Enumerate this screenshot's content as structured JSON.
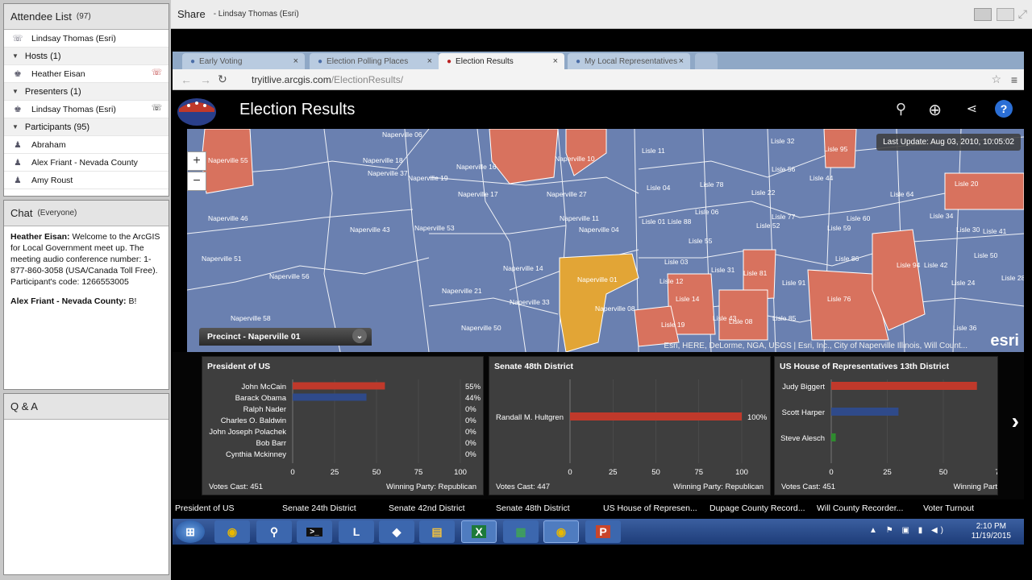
{
  "attendee": {
    "title": "Attendee List",
    "count": "(97)",
    "presenter_self": "Lindsay Thomas (Esri)",
    "hosts_label": "Hosts (1)",
    "hosts": [
      "Heather Eisan"
    ],
    "presenters_label": "Presenters (1)",
    "presenters": [
      "Lindsay Thomas (Esri)"
    ],
    "participants_label": "Participants (95)",
    "participants": [
      "Abraham",
      "Alex Friant - Nevada County",
      "Amy Roust"
    ]
  },
  "chat": {
    "title": "Chat",
    "scope": "(Everyone)",
    "messages": [
      {
        "sender": "Heather Eisan:",
        "text": " Welcome to the ArcGIS for Local Government meet up. The meeting audio conference number: 1-877-860-3058 (USA/Canada Toll Free). Participant's code: 1266553005"
      },
      {
        "sender": "Alex Friant - Nevada County:",
        "text": " B!"
      }
    ]
  },
  "qa": {
    "title": "Q & A"
  },
  "share": {
    "title": "Share",
    "presenter": "- Lindsay Thomas (Esri)"
  },
  "browser": {
    "tabs": [
      "Early Voting",
      "Election Polling Places",
      "Election Results",
      "My Local Representatives"
    ],
    "url_host": "tryitlive.arcgis.com",
    "url_path": "/ElectionResults/"
  },
  "app": {
    "title": "Election Results",
    "last_update": "Last Update: Aug 03, 2010, 10:05:02",
    "precinct": "Precinct - Naperville 01",
    "attribution": "Esri, HERE, DeLorme, NGA, USGS | Esri, Inc., City of Naperville Illinois, Will Count...",
    "esri": "esri",
    "zoom_in": "+",
    "zoom_out": "−"
  },
  "map_labels": [
    "Naperville 55",
    "Naperville 18",
    "Naperville 37",
    "Naperville 19",
    "Naperville 16",
    "Naperville 10",
    "Lisle 11",
    "Lisle 32",
    "Lisle 95",
    "Naperville 17",
    "Naperville 27",
    "Lisle 04",
    "Lisle 78",
    "Lisle 56",
    "Lisle 44",
    "Lisle 20",
    "Lisle 22",
    "Lisle 64",
    "Naperville 46",
    "Naperville 43",
    "Naperville 53",
    "Naperville 11",
    "Naperville 04",
    "Lisle 01",
    "Lisle 88",
    "Lisle 06",
    "Lisle 77",
    "Lisle 60",
    "Lisle 34",
    "Lisle 52",
    "Lisle 59",
    "Lisle 30",
    "Lisle 41",
    "Lisle 55",
    "Naperville 51",
    "Naperville 56",
    "Naperville 14",
    "Naperville 01",
    "Lisle 03",
    "Lisle 31",
    "Lisle 81",
    "Lisle 86",
    "Lisle 94",
    "Lisle 42",
    "Lisle 50",
    "Lisle 12",
    "Lisle 91",
    "Lisle 24",
    "Lisle 28",
    "Naperville 21",
    "Naperville 33",
    "Naperville 08",
    "Lisle 14",
    "Lisle 76",
    "Naperville 58",
    "Naperville 50",
    "Lisle 19",
    "Lisle 43",
    "Lisle 08",
    "Lisle 85",
    "Lisle 36",
    "Naperville 06"
  ],
  "chart_data": [
    {
      "type": "bar",
      "title": "President of US",
      "categories": [
        "John McCain",
        "Barack Obama",
        "Ralph Nader",
        "Charles O. Baldwin",
        "John Joseph Polachek",
        "Bob Barr",
        "Cynthia Mckinney"
      ],
      "values": [
        55,
        44,
        0,
        0,
        0,
        0,
        0
      ],
      "value_labels": [
        "55%",
        "44%",
        "0%",
        "0%",
        "0%",
        "0%",
        "0%"
      ],
      "colors": [
        "#c0392b",
        "#2f4a8a",
        "#666",
        "#666",
        "#666",
        "#666",
        "#666"
      ],
      "xlim": [
        0,
        100
      ],
      "xticks": [
        "0",
        "25",
        "50",
        "75",
        "100"
      ],
      "votes_cast": "Votes Cast: 451",
      "winning": "Winning Party: Republican"
    },
    {
      "type": "bar",
      "title": "Senate 48th District",
      "categories": [
        "Randall M. Hultgren"
      ],
      "values": [
        100
      ],
      "value_labels": [
        "100%"
      ],
      "colors": [
        "#c0392b"
      ],
      "xlim": [
        0,
        100
      ],
      "xticks": [
        "0",
        "25",
        "50",
        "75",
        "100"
      ],
      "votes_cast": "Votes Cast: 447",
      "winning": "Winning Party: Republican"
    },
    {
      "type": "bar",
      "title": "US House of Representatives 13th District",
      "categories": [
        "Judy Biggert",
        "Scott Harper",
        "Steve Alesch"
      ],
      "values": [
        65,
        30,
        2
      ],
      "value_labels": [
        "",
        "",
        ""
      ],
      "colors": [
        "#c0392b",
        "#2f4a8a",
        "#2e8b2e"
      ],
      "xlim": [
        0,
        100
      ],
      "xticks": [
        "0",
        "25",
        "50",
        "75"
      ],
      "votes_cast": "Votes Cast: 451",
      "winning": "Winning Part"
    }
  ],
  "bottom_tabs": [
    "President of US",
    "Senate 24th District",
    "Senate 42nd District",
    "Senate 48th District",
    "US House of Represen...",
    "Dupage County Record...",
    "Will County Recorder...",
    "Voter Turnout"
  ],
  "clock": {
    "time": "2:10 PM",
    "date": "11/19/2015"
  }
}
